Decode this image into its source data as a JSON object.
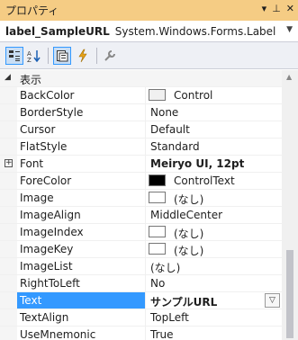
{
  "window": {
    "title": "プロパティ",
    "controls": {
      "pin": "▾",
      "dock": "⊥",
      "close": "✕"
    }
  },
  "object_selector": {
    "name": "label_SampleURL",
    "type": "System.Windows.Forms.Label"
  },
  "toolbar": {
    "buttons": [
      {
        "icon": "categorized-icon",
        "active": true
      },
      {
        "icon": "alphabetical-icon",
        "active": false
      },
      {
        "icon": "properties-icon",
        "active": true
      },
      {
        "icon": "events-icon",
        "active": false
      },
      {
        "icon": "property-pages-icon",
        "active": false
      }
    ]
  },
  "grid": {
    "category": "表示",
    "rows": [
      {
        "name": "BackColor",
        "value": "Control",
        "swatch": "#f0f0f0"
      },
      {
        "name": "BorderStyle",
        "value": "None"
      },
      {
        "name": "Cursor",
        "value": "Default"
      },
      {
        "name": "FlatStyle",
        "value": "Standard"
      },
      {
        "name": "Font",
        "value": "Meiryo UI, 12pt",
        "bold": true,
        "expandable": true
      },
      {
        "name": "ForeColor",
        "value": "ControlText",
        "swatch": "#000000"
      },
      {
        "name": "Image",
        "value": "(なし)",
        "swatch": "#ffffff"
      },
      {
        "name": "ImageAlign",
        "value": "MiddleCenter"
      },
      {
        "name": "ImageIndex",
        "value": "(なし)",
        "swatch": "#ffffff"
      },
      {
        "name": "ImageKey",
        "value": "(なし)",
        "swatch": "#ffffff"
      },
      {
        "name": "ImageList",
        "value": "(なし)"
      },
      {
        "name": "RightToLeft",
        "value": "No"
      },
      {
        "name": "Text",
        "value": "サンプルURL",
        "bold": true,
        "selected": true
      },
      {
        "name": "TextAlign",
        "value": "TopLeft"
      },
      {
        "name": "UseMnemonic",
        "value": "True"
      }
    ]
  },
  "colors": {
    "titlebar": "#f5cc84",
    "selection": "#3399ff"
  }
}
